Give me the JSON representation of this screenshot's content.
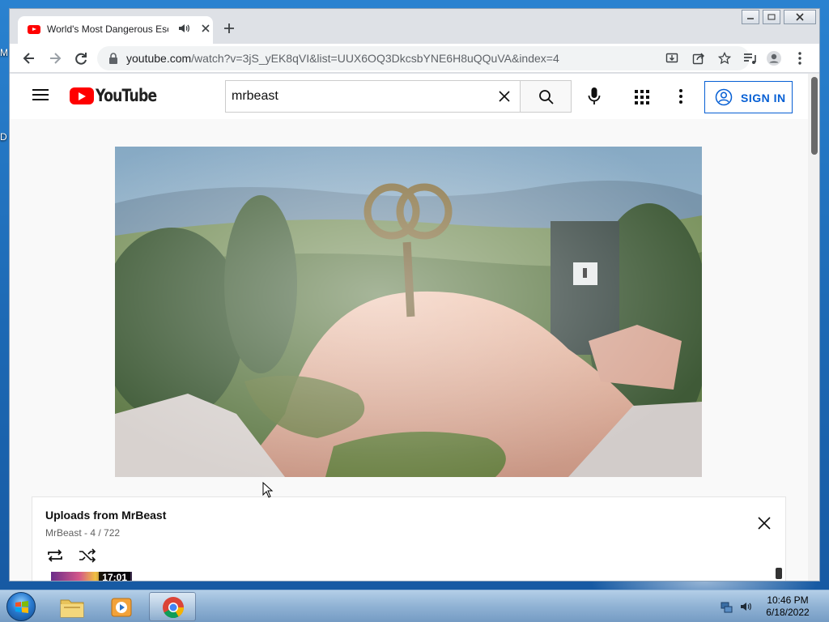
{
  "desktop": {
    "edge_letters": [
      "M",
      "D"
    ]
  },
  "browser": {
    "tab": {
      "title": "World's Most Dangerous Esc",
      "favicon": "youtube-favicon"
    },
    "address": {
      "host": "youtube.com",
      "path": "/watch?v=3jS_yEK8qVI&list=UUX6OQ3DkcsbYNE6H8uQQuVA&index=4"
    },
    "icons": [
      "back-icon",
      "forward-icon",
      "reload-icon",
      "lock-icon",
      "install-icon",
      "share-icon",
      "star-icon",
      "media-icon",
      "profile-icon",
      "menu-icon"
    ]
  },
  "youtube": {
    "wordmark": "YouTube",
    "search": {
      "value": "mrbeast",
      "placeholder": "Search"
    },
    "signin_label": "SIGN IN"
  },
  "playlist": {
    "title": "Uploads from MrBeast",
    "channel": "MrBeast",
    "position": "4 / 722",
    "separator": " - ",
    "next_thumb_duration": "17:01"
  },
  "taskbar": {
    "time": "10:46 PM",
    "date": "6/18/2022",
    "apps": [
      "explorer",
      "media-player",
      "chrome"
    ]
  }
}
